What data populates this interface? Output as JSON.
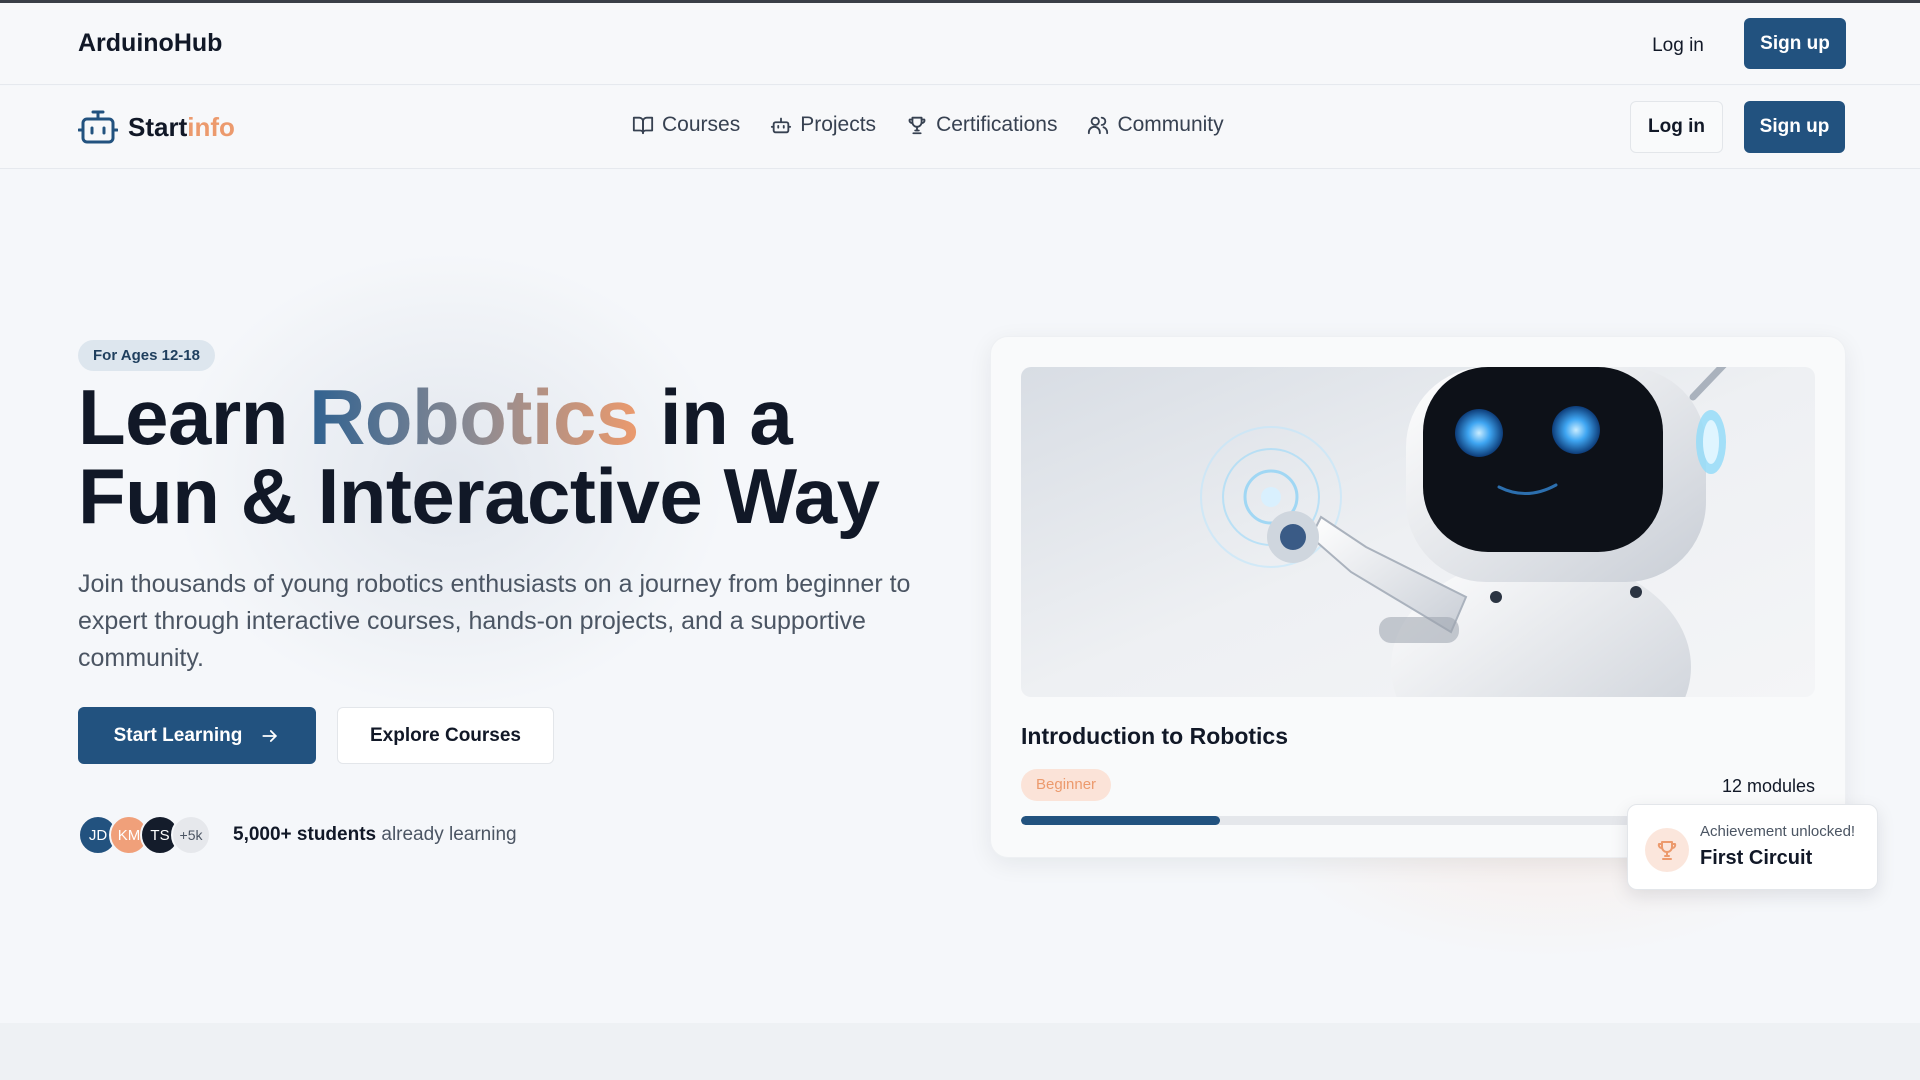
{
  "topbar": {
    "brand": "ArduinoHub",
    "login_label": "Log in",
    "signup_label": "Sign up"
  },
  "navbar": {
    "logo_part1": "Start",
    "logo_part2": "info",
    "links": [
      {
        "label": "Courses",
        "icon": "book-open-icon"
      },
      {
        "label": "Projects",
        "icon": "robot-icon"
      },
      {
        "label": "Certifications",
        "icon": "trophy-icon"
      },
      {
        "label": "Community",
        "icon": "users-icon"
      }
    ],
    "login_label": "Log in",
    "signup_label": "Sign up"
  },
  "hero": {
    "badge": "For Ages 12-18",
    "title_before": "Learn ",
    "title_accent": "Robotics",
    "title_after": " in a Fun & Interactive Way",
    "description": "Join thousands of young robotics enthusiasts on a journey from beginner to expert through interactive courses, hands-on projects, and a supportive community.",
    "primary_cta": "Start Learning",
    "secondary_cta": "Explore Courses",
    "avatars": [
      "JD",
      "KM",
      "TS",
      "+5k"
    ],
    "students_count": "5,000+ students",
    "students_suffix": " already learning"
  },
  "course_card": {
    "image": "robot-illustration",
    "title": "Introduction to Robotics",
    "level": "Beginner",
    "modules": "12 modules",
    "progress_percent": 25
  },
  "achievement": {
    "icon": "trophy-icon",
    "subtitle": "Achievement unlocked!",
    "title": "First Circuit"
  },
  "colors": {
    "primary": "#22527f",
    "accent": "#ec9a6d",
    "text_dark": "#111827",
    "text_muted": "#4b5563"
  }
}
